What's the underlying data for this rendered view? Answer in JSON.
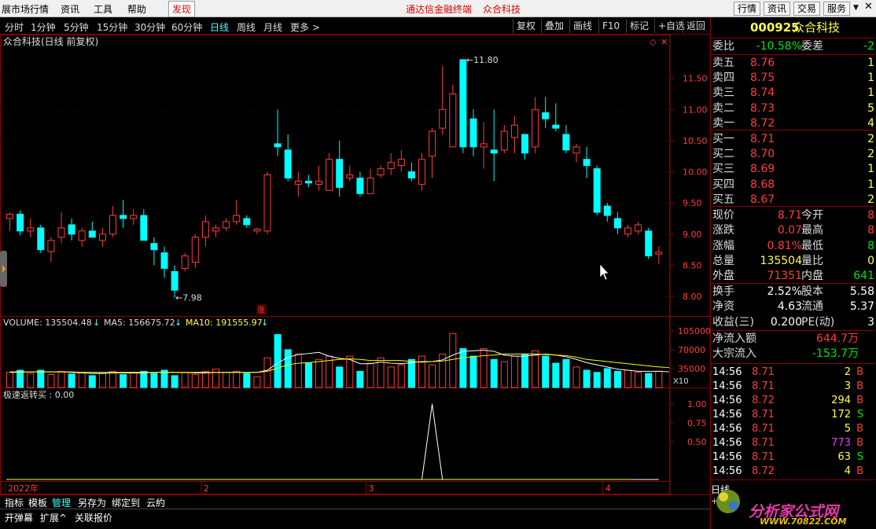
{
  "menubar": {
    "items": [
      "展市场行情",
      "资讯",
      "工具",
      "帮助"
    ],
    "highlight": "发现",
    "center_title": "通达信金融终端",
    "center_stock": "众合科技",
    "right_buttons": [
      "行情",
      "资讯",
      "交易",
      "服务"
    ]
  },
  "periodbar": {
    "periods": [
      "分时",
      "1分钟",
      "5分钟",
      "15分钟",
      "30分钟",
      "60分钟",
      "日线",
      "周线",
      "月线",
      "更多 >"
    ],
    "active": "日线",
    "right_buttons": [
      "复权",
      "叠加",
      "画线",
      "F10",
      "标记",
      "+自选",
      "返回"
    ]
  },
  "chart_title": "众合科技(日线 前复权)",
  "chart_data": [
    {
      "type": "candlestick",
      "title": "众合科技(日线 前复权)",
      "y_ticks": [
        8.0,
        8.5,
        9.0,
        9.5,
        10.0,
        10.5,
        11.0,
        11.5
      ],
      "ylim": [
        7.85,
        11.95
      ],
      "annotations": {
        "high": "11.80",
        "low": "7.98",
        "marker": "涨"
      },
      "x_labels": [
        "2022年",
        "2",
        "3",
        "4"
      ],
      "candles": [
        {
          "o": 9.25,
          "h": 9.35,
          "l": 9.05,
          "c": 9.32
        },
        {
          "o": 9.32,
          "h": 9.38,
          "l": 8.98,
          "c": 9.05
        },
        {
          "o": 9.05,
          "h": 9.25,
          "l": 8.95,
          "c": 9.1
        },
        {
          "o": 9.1,
          "h": 9.15,
          "l": 8.7,
          "c": 8.75
        },
        {
          "o": 8.72,
          "h": 8.95,
          "l": 8.55,
          "c": 8.9
        },
        {
          "o": 8.95,
          "h": 9.35,
          "l": 8.85,
          "c": 9.1
        },
        {
          "o": 9.15,
          "h": 9.25,
          "l": 8.9,
          "c": 9.0
        },
        {
          "o": 8.9,
          "h": 9.1,
          "l": 8.8,
          "c": 9.05
        },
        {
          "o": 9.05,
          "h": 9.2,
          "l": 8.95,
          "c": 8.95
        },
        {
          "o": 8.9,
          "h": 9.1,
          "l": 8.8,
          "c": 9.0
        },
        {
          "o": 9.0,
          "h": 9.45,
          "l": 8.95,
          "c": 9.3
        },
        {
          "o": 9.3,
          "h": 9.55,
          "l": 9.1,
          "c": 9.25
        },
        {
          "o": 9.25,
          "h": 9.4,
          "l": 9.15,
          "c": 9.3
        },
        {
          "o": 9.3,
          "h": 9.4,
          "l": 8.95,
          "c": 8.9
        },
        {
          "o": 8.85,
          "h": 8.95,
          "l": 8.5,
          "c": 8.75
        },
        {
          "o": 8.7,
          "h": 8.8,
          "l": 8.3,
          "c": 8.45
        },
        {
          "o": 8.4,
          "h": 8.5,
          "l": 7.98,
          "c": 8.1
        },
        {
          "o": 8.45,
          "h": 8.7,
          "l": 8.4,
          "c": 8.65
        },
        {
          "o": 8.55,
          "h": 9.0,
          "l": 8.45,
          "c": 8.95
        },
        {
          "o": 8.95,
          "h": 9.3,
          "l": 8.8,
          "c": 9.2
        },
        {
          "o": 9.05,
          "h": 9.15,
          "l": 8.95,
          "c": 9.1
        },
        {
          "o": 9.1,
          "h": 9.25,
          "l": 9.05,
          "c": 9.2
        },
        {
          "o": 9.2,
          "h": 9.55,
          "l": 9.15,
          "c": 9.3
        },
        {
          "o": 9.25,
          "h": 9.3,
          "l": 9.1,
          "c": 9.15
        },
        {
          "o": 9.05,
          "h": 9.1,
          "l": 9.0,
          "c": 9.08
        },
        {
          "o": 9.05,
          "h": 10.0,
          "l": 9.0,
          "c": 9.95
        },
        {
          "o": 10.45,
          "h": 11.0,
          "l": 10.25,
          "c": 10.4
        },
        {
          "o": 10.35,
          "h": 10.6,
          "l": 9.85,
          "c": 9.9
        },
        {
          "o": 9.8,
          "h": 10.0,
          "l": 9.6,
          "c": 9.85
        },
        {
          "o": 9.85,
          "h": 9.95,
          "l": 9.75,
          "c": 9.82
        },
        {
          "o": 9.8,
          "h": 10.1,
          "l": 9.7,
          "c": 9.85
        },
        {
          "o": 9.7,
          "h": 10.3,
          "l": 9.7,
          "c": 10.2
        },
        {
          "o": 10.2,
          "h": 10.5,
          "l": 9.6,
          "c": 9.75
        },
        {
          "o": 9.9,
          "h": 10.1,
          "l": 9.85,
          "c": 9.95
        },
        {
          "o": 9.9,
          "h": 10.0,
          "l": 9.6,
          "c": 9.65
        },
        {
          "o": 9.65,
          "h": 10.05,
          "l": 9.65,
          "c": 9.9
        },
        {
          "o": 9.95,
          "h": 10.1,
          "l": 9.9,
          "c": 10.05
        },
        {
          "o": 10.05,
          "h": 10.3,
          "l": 9.95,
          "c": 10.15
        },
        {
          "o": 10.1,
          "h": 10.35,
          "l": 10.0,
          "c": 10.2
        },
        {
          "o": 10.0,
          "h": 10.15,
          "l": 9.85,
          "c": 9.9
        },
        {
          "o": 9.8,
          "h": 10.3,
          "l": 9.7,
          "c": 10.2
        },
        {
          "o": 10.25,
          "h": 10.7,
          "l": 9.9,
          "c": 10.65
        },
        {
          "o": 10.7,
          "h": 11.7,
          "l": 10.6,
          "c": 11.0
        },
        {
          "o": 10.4,
          "h": 11.4,
          "l": 10.4,
          "c": 11.25
        },
        {
          "o": 11.8,
          "h": 11.8,
          "l": 10.3,
          "c": 10.4
        },
        {
          "o": 10.85,
          "h": 11.0,
          "l": 10.25,
          "c": 10.4
        },
        {
          "o": 10.4,
          "h": 10.8,
          "l": 10.05,
          "c": 10.45
        },
        {
          "o": 10.35,
          "h": 11.0,
          "l": 9.85,
          "c": 10.3
        },
        {
          "o": 10.35,
          "h": 10.75,
          "l": 10.3,
          "c": 10.65
        },
        {
          "o": 10.55,
          "h": 10.9,
          "l": 10.3,
          "c": 10.75
        },
        {
          "o": 10.6,
          "h": 10.6,
          "l": 10.2,
          "c": 10.3
        },
        {
          "o": 10.4,
          "h": 11.2,
          "l": 10.3,
          "c": 11.0
        },
        {
          "o": 10.95,
          "h": 11.2,
          "l": 10.7,
          "c": 10.85
        },
        {
          "o": 10.75,
          "h": 11.1,
          "l": 10.65,
          "c": 10.7
        },
        {
          "o": 10.6,
          "h": 10.75,
          "l": 10.3,
          "c": 10.35
        },
        {
          "o": 10.3,
          "h": 10.45,
          "l": 10.15,
          "c": 10.4
        },
        {
          "o": 10.2,
          "h": 10.4,
          "l": 9.9,
          "c": 10.1
        },
        {
          "o": 10.05,
          "h": 10.1,
          "l": 9.3,
          "c": 9.35
        },
        {
          "o": 9.45,
          "h": 9.5,
          "l": 9.2,
          "c": 9.3
        },
        {
          "o": 9.25,
          "h": 9.35,
          "l": 9.0,
          "c": 9.1
        },
        {
          "o": 9.0,
          "h": 9.15,
          "l": 8.95,
          "c": 9.1
        },
        {
          "o": 9.05,
          "h": 9.2,
          "l": 9.0,
          "c": 9.15
        },
        {
          "o": 9.05,
          "h": 9.1,
          "l": 8.6,
          "c": 8.65
        },
        {
          "o": 8.68,
          "h": 8.8,
          "l": 8.52,
          "c": 8.71
        }
      ]
    },
    {
      "type": "bar",
      "title": "VOLUME",
      "legend": [
        {
          "name": "VOLUME",
          "value": "135504.48"
        },
        {
          "name": "MA5",
          "value": "156675.72"
        },
        {
          "name": "MA10",
          "value": "191555.97"
        }
      ],
      "y_ticks": [
        "105000",
        "70000",
        "35000"
      ],
      "unit": "X10",
      "volumes_x10": [
        28,
        32,
        26,
        32,
        24,
        30,
        25,
        28,
        22,
        26,
        30,
        24,
        28,
        30,
        26,
        32,
        22,
        28,
        24,
        30,
        34,
        28,
        30,
        26,
        20,
        55,
        98,
        70,
        62,
        45,
        52,
        58,
        38,
        58,
        30,
        45,
        55,
        38,
        42,
        52,
        58,
        42,
        62,
        100,
        72,
        58,
        72,
        52,
        48,
        58,
        62,
        68,
        58,
        45,
        52,
        38,
        32,
        28,
        35,
        30,
        32,
        28,
        26,
        30,
        25
      ],
      "ma5_x10": [
        29,
        29,
        29,
        29,
        29,
        29,
        28,
        27,
        26,
        26,
        27,
        27,
        27,
        27,
        28,
        28,
        28,
        28,
        27,
        27,
        28,
        28,
        28,
        28,
        28,
        32,
        45,
        56,
        61,
        63,
        65,
        58,
        54,
        52,
        44,
        44,
        47,
        45,
        44,
        46,
        48,
        48,
        51,
        60,
        67,
        68,
        69,
        67,
        60,
        58,
        58,
        60,
        62,
        60,
        57,
        52,
        46,
        42,
        38,
        34,
        32,
        30,
        30,
        30,
        29
      ],
      "ma10_x10": [
        28,
        28,
        29,
        29,
        29,
        29,
        29,
        28,
        28,
        28,
        28,
        28,
        28,
        28,
        28,
        28,
        28,
        28,
        28,
        28,
        28,
        28,
        28,
        28,
        28,
        30,
        36,
        42,
        45,
        46,
        48,
        50,
        52,
        53,
        52,
        50,
        50,
        50,
        50,
        48,
        47,
        48,
        49,
        52,
        55,
        57,
        59,
        60,
        62,
        62,
        62,
        62,
        61,
        60,
        59,
        56,
        52,
        50,
        48,
        46,
        44,
        42,
        40,
        38,
        37
      ]
    },
    {
      "type": "line",
      "title": "极速返转买",
      "legend": [
        {
          "name": "极速返转买",
          "value": "0.00"
        }
      ],
      "y_ticks": [
        "1.00",
        "0.75",
        "0.50"
      ],
      "values": [
        0,
        0,
        0,
        0,
        0,
        0,
        0,
        0,
        0,
        0,
        0,
        0,
        0,
        0,
        0,
        0,
        0,
        0,
        0,
        0,
        0,
        0,
        0,
        0,
        0,
        0,
        0,
        0,
        0,
        0,
        0,
        0,
        0,
        0,
        0,
        0,
        0,
        0,
        0,
        0,
        0,
        1,
        0,
        0,
        0,
        0,
        0,
        0,
        0,
        0,
        0,
        0,
        0,
        0,
        0,
        0,
        0,
        0,
        0,
        0,
        0,
        0,
        0,
        0
      ]
    }
  ],
  "volume_legend": {
    "volume": "VOLUME: 135504.48",
    "ma5": "MA5: 156675.72",
    "ma10": "MA10: 191555.97",
    "unit": "X10"
  },
  "indicator_legend": "极速返转买 : 0.00",
  "right_panel": {
    "code": "000925",
    "name": "众合科技",
    "weibi_label": "委比",
    "weibi": "-10.58%",
    "weicha_label": "委差",
    "weicha": "-2",
    "sells": [
      {
        "label": "卖五",
        "price": "8.76",
        "vol": "1"
      },
      {
        "label": "卖四",
        "price": "8.75",
        "vol": "1"
      },
      {
        "label": "卖三",
        "price": "8.74",
        "vol": "1"
      },
      {
        "label": "卖二",
        "price": "8.73",
        "vol": "5"
      },
      {
        "label": "卖一",
        "price": "8.72",
        "vol": "4"
      }
    ],
    "buys": [
      {
        "label": "买一",
        "price": "8.71",
        "vol": "2"
      },
      {
        "label": "买二",
        "price": "8.70",
        "vol": "2"
      },
      {
        "label": "买三",
        "price": "8.69",
        "vol": "1"
      },
      {
        "label": "买四",
        "price": "8.68",
        "vol": "1"
      },
      {
        "label": "买五",
        "price": "8.67",
        "vol": "2"
      }
    ],
    "quote": [
      {
        "l1": "现价",
        "v1": "8.71",
        "c1": "red",
        "l2": "今开",
        "v2": "8",
        "c2": "red"
      },
      {
        "l1": "涨跌",
        "v1": "0.07",
        "c1": "red",
        "l2": "最高",
        "v2": "8",
        "c2": "red"
      },
      {
        "l1": "涨幅",
        "v1": "0.81%",
        "c1": "red",
        "l2": "最低",
        "v2": "8",
        "c2": "green"
      },
      {
        "l1": "总量",
        "v1": "135504",
        "c1": "yellow",
        "l2": "量比",
        "v2": "0",
        "c2": "yellow"
      },
      {
        "l1": "外盘",
        "v1": "71351",
        "c1": "red",
        "l2": "内盘",
        "v2": "641",
        "c2": "green"
      }
    ],
    "quote2": [
      {
        "l1": "换手",
        "v1": "2.52%",
        "c1": "white",
        "l2": "股本",
        "v2": "5.58",
        "c2": "white"
      },
      {
        "l1": "净资",
        "v1": "4.63",
        "c1": "white",
        "l2": "流通",
        "v2": "5.37",
        "c2": "white"
      },
      {
        "l1": "收益(三)",
        "v1": "0.200",
        "c1": "white",
        "l2": "PE(动)",
        "v2": "3",
        "c2": "white"
      }
    ],
    "flow": [
      {
        "label": "净流入额",
        "value": "644.7万",
        "color": "red"
      },
      {
        "label": "大宗流入",
        "value": "-153.7万",
        "color": "green"
      }
    ],
    "ticks": [
      {
        "time": "14:56",
        "price": "8.71",
        "vol": "2",
        "vcolor": "yellow",
        "side": "B",
        "scolor": "red"
      },
      {
        "time": "14:56",
        "price": "8.71",
        "vol": "3",
        "vcolor": "yellow",
        "side": "B",
        "scolor": "red"
      },
      {
        "time": "14:56",
        "price": "8.72",
        "vol": "294",
        "vcolor": "yellow",
        "side": "B",
        "scolor": "red"
      },
      {
        "time": "14:56",
        "price": "8.71",
        "vol": "172",
        "vcolor": "yellow",
        "side": "S",
        "scolor": "green"
      },
      {
        "time": "14:56",
        "price": "8.71",
        "vol": "5",
        "vcolor": "yellow",
        "side": "B",
        "scolor": "red"
      },
      {
        "time": "14:56",
        "price": "8.71",
        "vol": "773",
        "vcolor": "magenta",
        "side": "B",
        "scolor": "red"
      },
      {
        "time": "14:56",
        "price": "8.71",
        "vol": "63",
        "vcolor": "yellow",
        "side": "S",
        "scolor": "green"
      },
      {
        "time": "14:56",
        "price": "8.72",
        "vol": "4",
        "vcolor": "yellow",
        "side": "B",
        "scolor": "red"
      }
    ],
    "bottom_label": "日线"
  },
  "tabbar": [
    "指标",
    "模板",
    "管理",
    "另存为",
    "绑定到",
    "云約"
  ],
  "tabbar_active": "管理",
  "bottombar": [
    "开弹幕",
    "扩展^",
    "关联报价"
  ],
  "watermark": {
    "line1": "分析家公式网",
    "line2": "WWW.70822.COM"
  },
  "colors": {
    "up": "#ff3c3c",
    "down": "#00ffff",
    "ma5": "#ffffff",
    "ma10": "#ffff00",
    "indicator": "#ffffff",
    "frame": "#8b0000"
  }
}
